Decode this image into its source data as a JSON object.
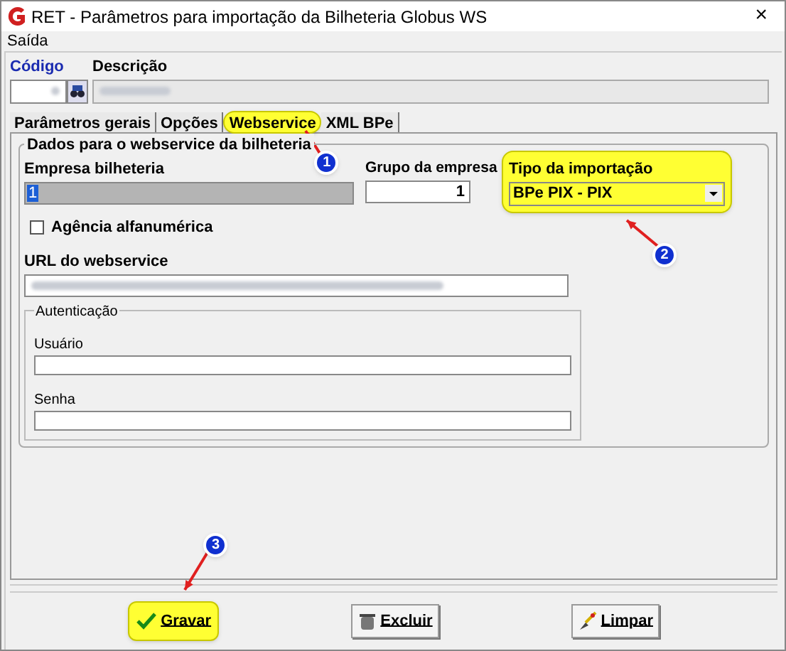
{
  "window": {
    "title": "RET - Parâmetros para importação da Bilheteria Globus WS",
    "close": "×"
  },
  "menu": [
    "Saída"
  ],
  "header": {
    "code_label": "Código",
    "description_label": "Descrição"
  },
  "tabs": [
    {
      "label": "Parâmetros gerais",
      "selected": false,
      "highlighted": false
    },
    {
      "label": "Opções",
      "selected": false,
      "highlighted": false
    },
    {
      "label": "Webservice",
      "selected": true,
      "highlighted": true,
      "callout": "1"
    },
    {
      "label": "XML BPe",
      "selected": false,
      "highlighted": false
    }
  ],
  "group": {
    "title": "Dados para o webservice da bilheteria",
    "empresa": {
      "label": "Empresa bilheteria",
      "value": "1",
      "disabled": true
    },
    "grupo": {
      "label": "Grupo da empresa",
      "value": "1"
    },
    "tipo": {
      "label": "Tipo da importação",
      "value": "BPe PIX - PIX",
      "highlighted": true,
      "callout": "2"
    },
    "agencia": {
      "label": "Agência alfanumérica",
      "checked": false
    },
    "url": {
      "label": "URL do webservice"
    },
    "auth": {
      "title": "Autenticação",
      "user_label": "Usuário",
      "password_label": "Senha"
    }
  },
  "buttons": [
    {
      "kind": "save",
      "label": "Gravar",
      "highlighted": true,
      "callout": "3"
    },
    {
      "kind": "delete",
      "label": "Excluir",
      "highlighted": false
    },
    {
      "kind": "clear",
      "label": "Limpar",
      "highlighted": false
    }
  ]
}
